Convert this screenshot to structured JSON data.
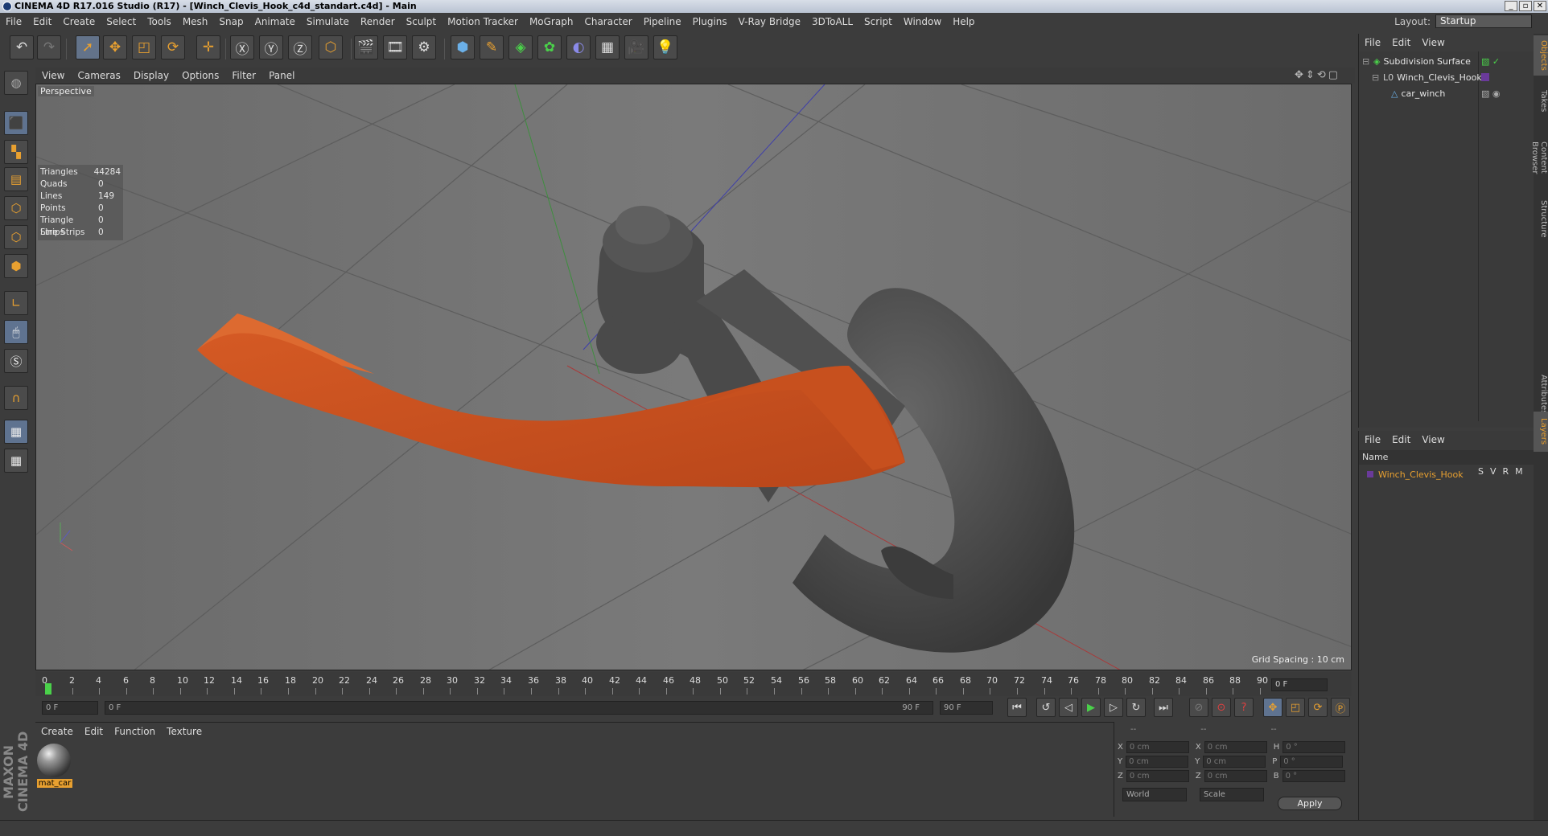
{
  "window": {
    "title": "CINEMA 4D R17.016 Studio (R17) - [Winch_Clevis_Hook_c4d_standart.c4d] - Main",
    "controls": [
      "_",
      "▫",
      "✕"
    ]
  },
  "menu": [
    "File",
    "Edit",
    "Create",
    "Select",
    "Tools",
    "Mesh",
    "Snap",
    "Animate",
    "Simulate",
    "Render",
    "Sculpt",
    "Motion Tracker",
    "MoGraph",
    "Character",
    "Pipeline",
    "Plugins",
    "V-Ray Bridge",
    "3DToALL",
    "Script",
    "Window",
    "Help"
  ],
  "layout": {
    "label": "Layout:",
    "value": "Startup"
  },
  "viewport": {
    "menu": [
      "View",
      "Cameras",
      "Display",
      "Options",
      "Filter",
      "Panel"
    ],
    "label": "Perspective",
    "stats": [
      {
        "k": "Triangles",
        "v": "44284"
      },
      {
        "k": "Quads",
        "v": "0"
      },
      {
        "k": "Lines",
        "v": "149"
      },
      {
        "k": "Points",
        "v": "0"
      },
      {
        "k": "Triangle Strips",
        "v": "0"
      },
      {
        "k": "Line Strips",
        "v": "0"
      }
    ],
    "grid_spacing": "Grid Spacing : 10 cm",
    "colors": {
      "strap": "#d55a24",
      "hook": "#4a4a4a"
    }
  },
  "timeline": {
    "ticks": [
      "0",
      "2",
      "4",
      "6",
      "8",
      "10",
      "12",
      "14",
      "16",
      "18",
      "20",
      "22",
      "24",
      "26",
      "28",
      "30",
      "32",
      "34",
      "36",
      "38",
      "40",
      "42",
      "44",
      "46",
      "48",
      "50",
      "52",
      "54",
      "56",
      "58",
      "60",
      "62",
      "64",
      "66",
      "68",
      "70",
      "72",
      "74",
      "76",
      "78",
      "80",
      "82",
      "84",
      "86",
      "88",
      "90"
    ],
    "current": "0 F"
  },
  "playback": {
    "start": "0 F",
    "range_start": "0 F",
    "range_end": "90 F",
    "end": "90 F"
  },
  "materials": {
    "menu": [
      "Create",
      "Edit",
      "Function",
      "Texture"
    ],
    "items": [
      {
        "name": "mat_car"
      }
    ]
  },
  "coords": {
    "headers": [
      "--",
      "--",
      "--"
    ],
    "rows": [
      {
        "a": "X",
        "av": "0 cm",
        "b": "X",
        "bv": "0 cm",
        "c": "H",
        "cv": "0 °"
      },
      {
        "a": "Y",
        "av": "0 cm",
        "b": "Y",
        "bv": "0 cm",
        "c": "P",
        "cv": "0 °"
      },
      {
        "a": "Z",
        "av": "0 cm",
        "b": "Z",
        "bv": "0 cm",
        "c": "B",
        "cv": "0 °"
      }
    ],
    "mode1": "World",
    "mode2": "Scale",
    "apply": "Apply"
  },
  "objects": {
    "menu": [
      "File",
      "Edit",
      "View"
    ],
    "items": [
      {
        "name": "Subdivision Surface"
      },
      {
        "name": "Winch_Clevis_Hook"
      },
      {
        "name": "car_winch"
      }
    ]
  },
  "layers": {
    "menu": [
      "File",
      "Edit",
      "View"
    ],
    "header": "Name",
    "cols": [
      "S",
      "V",
      "R",
      "M"
    ],
    "items": [
      {
        "name": "Winch_Clevis_Hook"
      }
    ]
  },
  "right_tabs": [
    "Objects",
    "Takes",
    "Content Browser",
    "Structure",
    "Attributes",
    "Layers"
  ]
}
